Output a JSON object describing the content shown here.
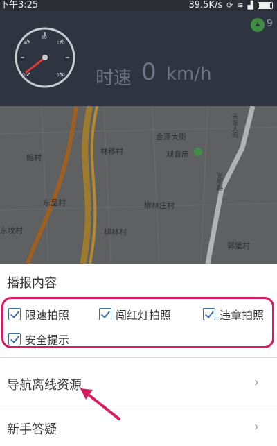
{
  "status_bar": {
    "time": "下午3:25",
    "network_speed": "39.5K/s"
  },
  "speed": {
    "label": "时速",
    "value": "0",
    "unit": "km/h",
    "gauge_ticks": [
      "0",
      "40",
      "80",
      "120",
      "160"
    ]
  },
  "gps": {
    "text": "9"
  },
  "map": {
    "labels": [
      "金泽大街",
      "鲍村",
      "林移村",
      "观音庙",
      "东呈村",
      "柳林庄村",
      "柳林村",
      "郭堡村",
      "东坟村",
      "光明路",
      "天龙大街"
    ]
  },
  "panel": {
    "section_title": "播报内容",
    "options": [
      {
        "label": "限速拍照",
        "checked": true
      },
      {
        "label": "闯红灯拍照",
        "checked": true
      },
      {
        "label": "违章拍照",
        "checked": true
      },
      {
        "label": "安全提示",
        "checked": true
      }
    ],
    "rows": [
      {
        "label": "导航离线资源"
      },
      {
        "label": "新手答疑"
      }
    ]
  },
  "colors": {
    "highlight": "#d81b60",
    "header_bg": "#2e3440",
    "checkbox": "#3a6fb0"
  }
}
